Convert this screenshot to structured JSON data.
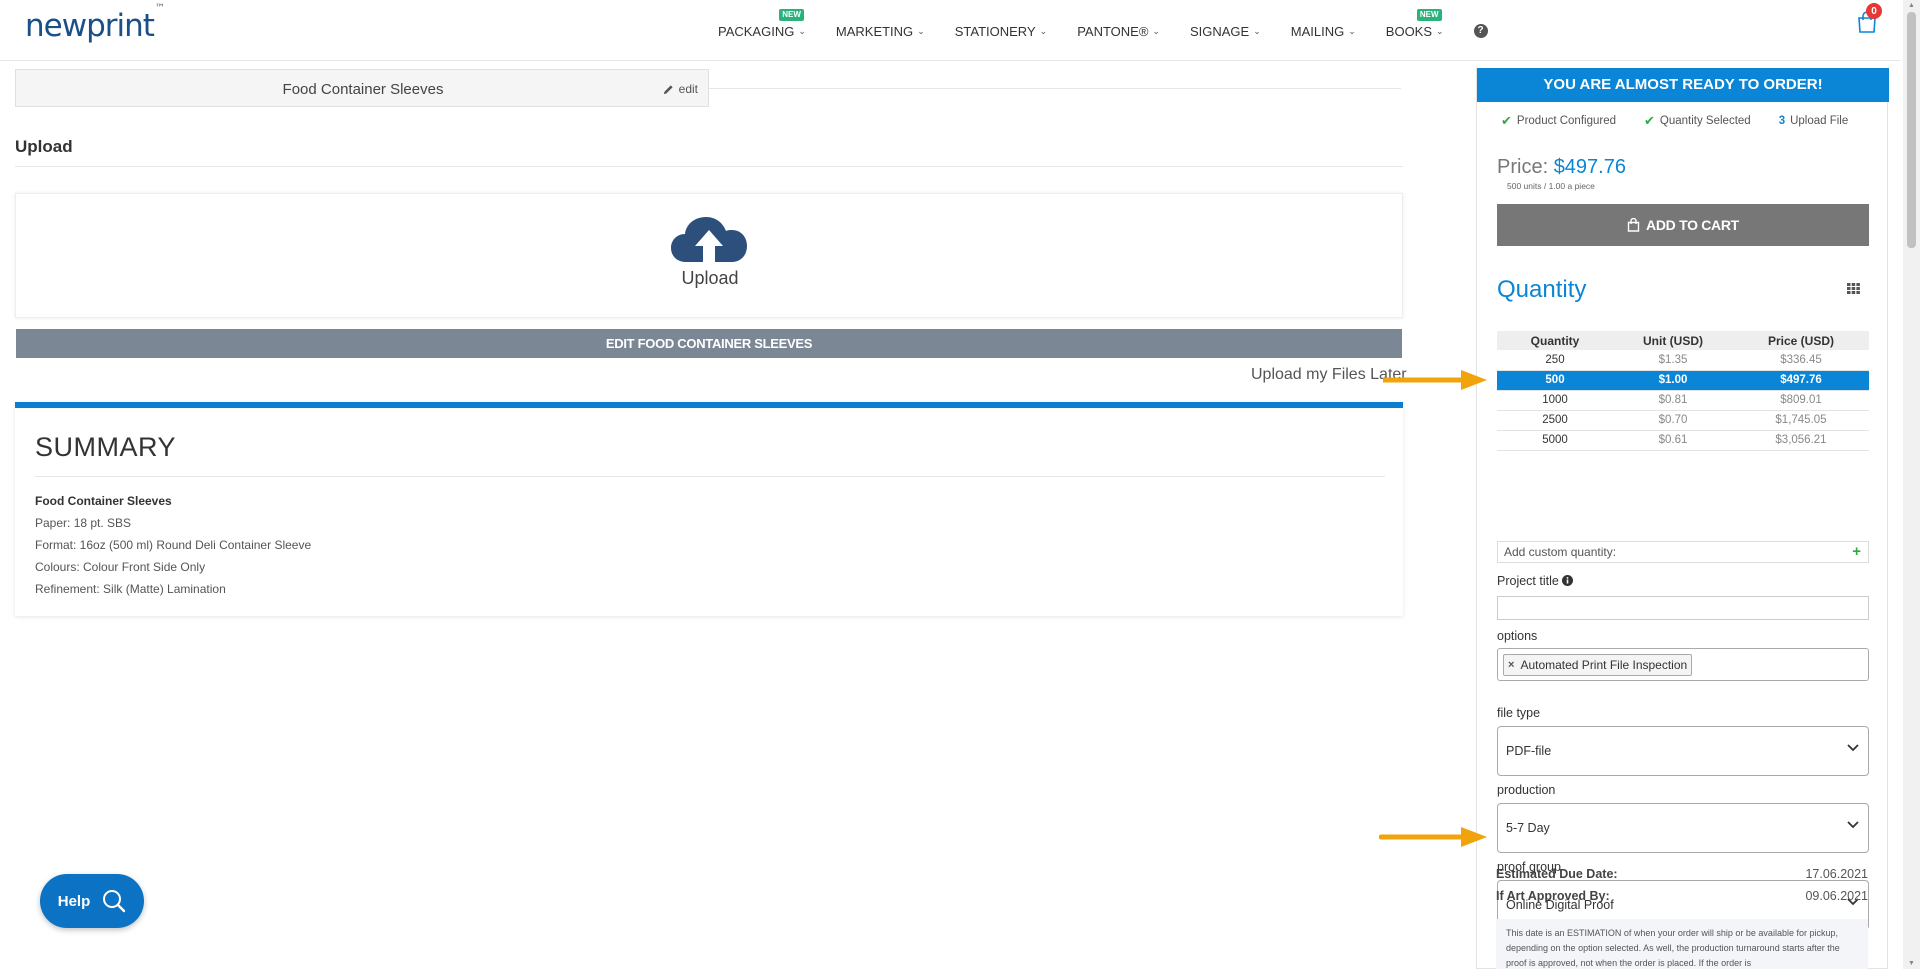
{
  "brand": {
    "logo_text": "newprint",
    "logo_mark": "™"
  },
  "nav": {
    "items": [
      {
        "label": "PACKAGING",
        "badge": "NEW"
      },
      {
        "label": "MARKETING",
        "badge": ""
      },
      {
        "label": "STATIONERY",
        "badge": ""
      },
      {
        "label": "PANTONE®",
        "badge": ""
      },
      {
        "label": "SIGNAGE",
        "badge": ""
      },
      {
        "label": "MAILING",
        "badge": ""
      },
      {
        "label": "BOOKS",
        "badge": "NEW"
      }
    ],
    "help_glyph": "?",
    "cart_count": "0"
  },
  "product": {
    "name": "Food Container Sleeves",
    "edit_label": "edit"
  },
  "upload": {
    "heading": "Upload",
    "box_label": "Upload",
    "edit_button": "EDIT FOOD CONTAINER SLEEVES",
    "later_link": "Upload my Files Later"
  },
  "summary": {
    "title": "SUMMARY",
    "product": "Food Container Sleeves",
    "lines": [
      "Paper: 18 pt. SBS",
      "Format: 16oz (500 ml) Round Deli Container Sleeve",
      "Colours: Colour Front Side Only",
      "Refinement: Silk (Matte) Lamination"
    ]
  },
  "help_button": {
    "label": "Help"
  },
  "sidebar": {
    "banner": "YOU ARE ALMOST READY TO ORDER!",
    "steps": [
      {
        "label": "Product Configured",
        "state": "done",
        "marker": "✔"
      },
      {
        "label": "Quantity Selected",
        "state": "done",
        "marker": "✔"
      },
      {
        "label": "Upload File",
        "state": "current",
        "marker": "3"
      }
    ],
    "price_label": "Price:",
    "price_value": "$497.76",
    "price_sub": "500 units / 1.00 a piece",
    "add_to_cart": "ADD TO CART",
    "quantity_title": "Quantity",
    "table": {
      "headers": [
        "Quantity",
        "Unit (USD)",
        "Price (USD)"
      ],
      "rows": [
        [
          "250",
          "$1.35",
          "$336.45"
        ],
        [
          "500",
          "$1.00",
          "$497.76"
        ],
        [
          "1000",
          "$0.81",
          "$809.01"
        ],
        [
          "2500",
          "$0.70",
          "$1,745.05"
        ],
        [
          "5000",
          "$0.61",
          "$3,056.21"
        ]
      ],
      "selected_index": 1
    },
    "custom_qty_placeholder": "Add custom quantity:",
    "project_title_label": "Project title",
    "project_title_value": "",
    "options_label": "options",
    "options_tag": "Automated Print File Inspection",
    "file_type_label": "file type",
    "file_type_value": "PDF-file",
    "production_label": "production",
    "production_value": "5-7 Day",
    "proof_group_label": "proof group",
    "proof_group_value": "Online Digital Proof",
    "due_label": "Estimated Due Date:",
    "due_value": "17.06.2021",
    "approved_label": "If Art Approved By:",
    "approved_value": "09.06.2021",
    "note": "This date is an ESTIMATION of when your order will ship or be available for pickup, depending on the option selected. As well, the production turnaround starts after the proof is approved, not when the order is placed. If the order is"
  },
  "colors": {
    "accent_blue": "#0b86d6",
    "arrow_orange": "#f0a30a",
    "check_green": "#2eaa3f",
    "badge_green": "#2ab27b",
    "button_grey": "#777777",
    "edit_bar": "#7b8794",
    "logo_blue": "#1a4f8a"
  }
}
